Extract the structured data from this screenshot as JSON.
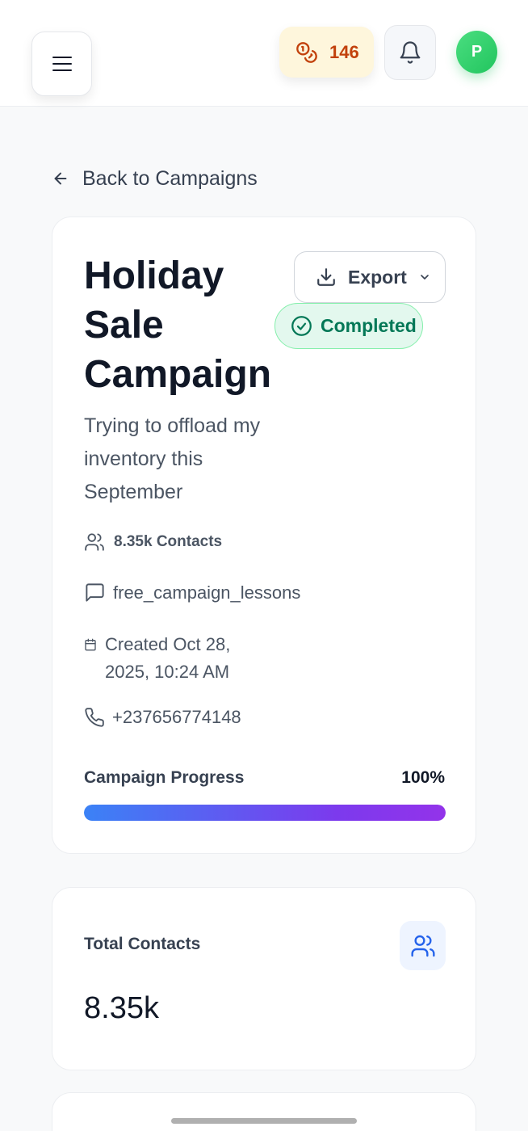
{
  "header": {
    "credits": "146",
    "avatar_initial": "P",
    "colors": {
      "credits_bg": "#fef6dc",
      "credits_text": "#c2410c",
      "avatar": "#22c55e"
    }
  },
  "back_link": {
    "label": "Back to Campaigns"
  },
  "campaign": {
    "title": "Holiday Sale Campaign",
    "export_label": "Export",
    "status": "Completed",
    "description": "Trying to offload my inventory this September",
    "contacts": "8.35k Contacts",
    "keyword": "free_campaign_lessons",
    "created": "Created Oct 28, 2025, 10:24 AM",
    "phone": "+237656774148",
    "progress_label": "Campaign Progress",
    "progress_value": "100%",
    "progress_fraction": 1.0
  },
  "stats": {
    "total_contacts_label": "Total Contacts",
    "total_contacts_value": "8.35k"
  },
  "icons": {
    "menu": "menu-icon",
    "credits": "coins-icon",
    "bell": "bell-icon",
    "back": "arrow-left-icon",
    "export": "download-icon",
    "chevron": "chevron-down-icon",
    "status": "check-circle-icon",
    "contacts": "users-icon",
    "keyword": "message-square-icon",
    "created": "calendar-icon",
    "phone": "phone-icon"
  }
}
